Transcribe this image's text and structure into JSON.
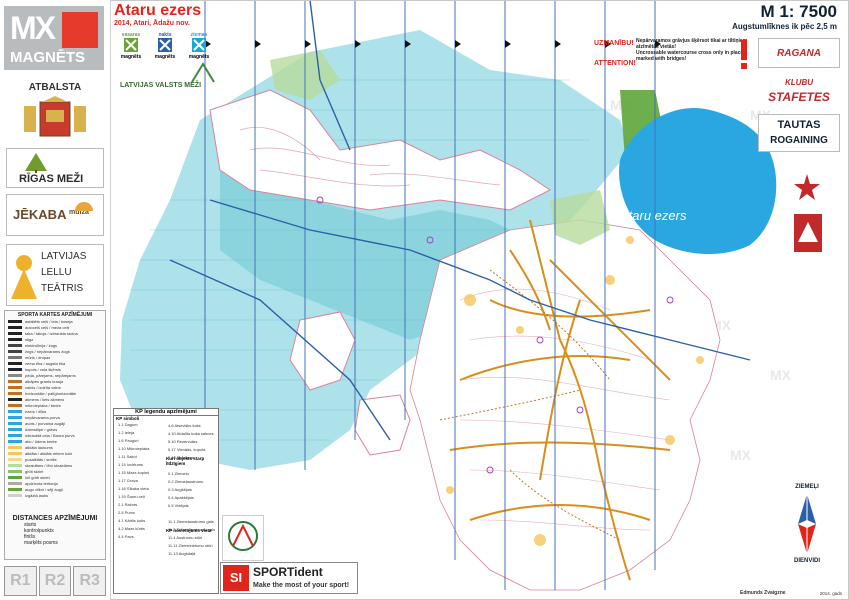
{
  "header": {
    "title": "Ataru ezers",
    "subtitle": "2014, Atari, Ādažu nov.",
    "scale": "M 1: 7500",
    "contour": "Augstumlīknes ik pēc 2,5 m"
  },
  "sidebar": {
    "brand_letters": "MX",
    "brand": "MAGNĒTS",
    "supported_by": "ATBALSTA",
    "sponsor_rigas": "RĪGAS MEŽI",
    "sponsor_jekaba": "JĒKABA",
    "sponsor_jekaba_sub": "muiža",
    "sponsor_teatris_1": "LATVIJAS",
    "sponsor_teatris_2": "LELLU",
    "sponsor_teatris_3": "TEĀTRIS",
    "legend_title": "SPORTA KARTES APZĪMĒJUMI",
    "legend_items": [
      "asfaltēts ceļš / iela / šoseja",
      "autoceļš ceļš / meža ceļš",
      "taka / takojs / izbraukta taciņa",
      "stiga",
      "elektrolīnija / žogs",
      "žogs / nepārvarams žogs",
      "mūris / drupas",
      "zema ēka / augsta ēka",
      "kupols / ceļa šķērsls",
      "pēda, pārejams, nepārejams",
      "atkāpes grants krauja",
      "valnis / izdzīta valne",
      "horizontāle / palīghorizontāle",
      "akmens / liels akmens",
      "mikroieplaka / bedre",
      "ezers / dīķis",
      "nepārvarama purva",
      "avots / purvaina augāji",
      "ūdenstilpe / grāvis",
      "izbrauktā ceļa / Baura purvs",
      "aku / ūdens bedre",
      "atklāta laukums",
      "atklāta / atklāts retiem koki",
      "pusatklāts / smilts",
      "skraidāms / lēni skraidāms",
      "grūti skriet",
      "ļoti grūti skriet",
      "apdzīvota teritorija",
      "augu vilkni / sēji augļi",
      "izgāztā lauks"
    ],
    "distances_title": "DISTANCES APZĪMĒJUMI",
    "distance_items": [
      "starts",
      "kontrolpunkts",
      "finišs",
      "marķēts posms"
    ],
    "runner_boxes": [
      "R1",
      "R2",
      "R3"
    ]
  },
  "top_logos": {
    "vasaras": "vasaras",
    "nakts": "nakts",
    "ziemas": "ziemas",
    "magnets": "magnēts",
    "latvijas_vm": "LATVIJAS VALSTS MEŽI"
  },
  "warning": {
    "title_lv": "UZMANĪBU!",
    "title_en": "ATTENTION!",
    "text_lv": "Nepārvaramos grāvjus šķērsot tikai ar tiltiņiem atzīmētās vietās!",
    "text_en": "Uncrossable watercourse cross only in places marked with bridges!"
  },
  "right_logos": {
    "ragana": "RAGANA",
    "klubu": "KLUBU",
    "stafetes": "STAFETES",
    "tautas": "TAUTAS",
    "rogaining": "ROGAINING"
  },
  "map": {
    "lake_label": "Ataru ezers",
    "north": "ZIEMEĻI",
    "south": "DIENVIDI"
  },
  "kp_legend": {
    "title": "KP legendu apzīmējumi",
    "section1": "KP simboli",
    "section2": "Kuri objekts starp līdzīgiem",
    "section3": "KP novietojums vieta",
    "items_left": [
      "1.1 Dagum",
      "1.2 Ieleja",
      "1.6 Pauguri",
      "1.10 Mikroieplaka",
      "1.11 Sakņi",
      "1.14 Izcirtums",
      "1.15 Mazs kupiņš",
      "1.17 Grava",
      "1.18 Sīkaka vieta",
      "1.19 Šauru ceļi",
      "2.1 Ražots",
      "2.5 Purvs",
      "4.1 Kārtlis koks",
      "4.2 Mazs kūrtis",
      "4.4 Pavs"
    ],
    "items_right": [
      "4.6 Atsevišķs koks",
      "4.10 Atdalīta koka saknes",
      "5.10 Rezervuārs",
      "5.17 Vienāds, kupola",
      "5.18 Barošana",
      "0.1 Ziemeļu",
      "0.2 Ziemeļaustrumu",
      "0.3 Augšējais",
      "0.4 Apakšējais",
      "0.5 Vidējais",
      "11.1 Ziemeļaustrumu gals",
      "11.2 Dienvidaustrumu gals",
      "11.4 Austrumu stūri",
      "11.11 Ziemeļrietumu stūri",
      "11.13 Augšdaļā"
    ]
  },
  "sportident": {
    "name": "SPORTident",
    "slogan": "Make the most of your sport!"
  },
  "credits": {
    "author": "Edmunds Zvaigzne",
    "year": "2014. gads"
  }
}
